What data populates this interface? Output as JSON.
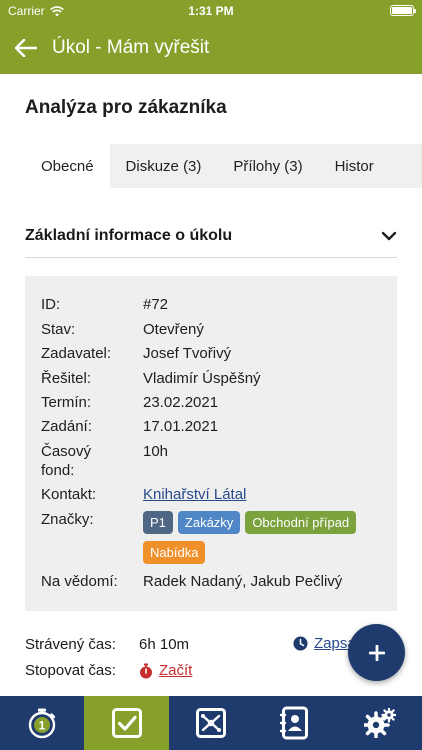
{
  "status_bar": {
    "carrier": "Carrier",
    "time": "1:31 PM",
    "wifi_icon": "wifi-icon",
    "battery_icon": "battery-icon"
  },
  "app_bar": {
    "title": "Úkol - Mám vyřešit",
    "back_icon": "arrow-left-icon"
  },
  "task": {
    "title": "Analýza pro zákazníka"
  },
  "tabs": [
    {
      "label": "Obecné",
      "active": true
    },
    {
      "label": "Diskuze (3)",
      "active": false
    },
    {
      "label": "Přílohy (3)",
      "active": false
    },
    {
      "label": "Histor",
      "active": false
    }
  ],
  "section": {
    "title": "Základní informace o úkolu",
    "toggle_icon": "chevron-down-icon"
  },
  "details": {
    "id": {
      "label": "ID:",
      "value": "#72"
    },
    "status": {
      "label": "Stav:",
      "value": "Otevřený"
    },
    "requester": {
      "label": "Zadavatel:",
      "value": "Josef Tvořivý"
    },
    "solver": {
      "label": "Řešitel:",
      "value": "Vladimír Úspěšný"
    },
    "deadline": {
      "label": "Termín:",
      "value": "23.02.2021"
    },
    "assigned": {
      "label": "Zadání:",
      "value": "17.01.2021"
    },
    "time_fund": {
      "label_line1": "Časový",
      "label_line2": "fond:",
      "value": "10h"
    },
    "contact": {
      "label": "Kontakt:",
      "value": "Knihařství Látal"
    },
    "tags_label": "Značky:",
    "tags": [
      {
        "label": "P1",
        "color": "#4f6684"
      },
      {
        "label": "Zakázky",
        "color": "#4f86c6"
      },
      {
        "label": "Obchodní případ",
        "color": "#7ba23d"
      },
      {
        "label": "Nabídka",
        "color": "#f0902a"
      }
    ],
    "watchers": {
      "label": "Na vědomí:",
      "value": "Radek Nadaný, Jakub Pečlivý"
    }
  },
  "time_tracking": {
    "spent_label": "Strávený čas:",
    "spent_value": "6h 10m",
    "track_label": "Stopovat čas:",
    "start_label": "Začít",
    "start_icon": "stopwatch-icon",
    "write_label": "Zapsa",
    "write_icon": "clock-icon"
  },
  "fab": {
    "icon": "plus-icon"
  },
  "bottom_nav": [
    {
      "name": "timer",
      "icon": "stopwatch-icon",
      "badge": "1",
      "active": false
    },
    {
      "name": "tasks",
      "icon": "checkbox-icon",
      "active": true
    },
    {
      "name": "workflow",
      "icon": "workflow-icon",
      "active": false
    },
    {
      "name": "contacts",
      "icon": "contact-book-icon",
      "active": false
    },
    {
      "name": "settings",
      "icon": "gears-icon",
      "active": false
    }
  ],
  "colors": {
    "brand_green": "#86a02b",
    "navy": "#1f3a6d",
    "link_blue": "#274b8b",
    "danger_red": "#c62f2f"
  }
}
